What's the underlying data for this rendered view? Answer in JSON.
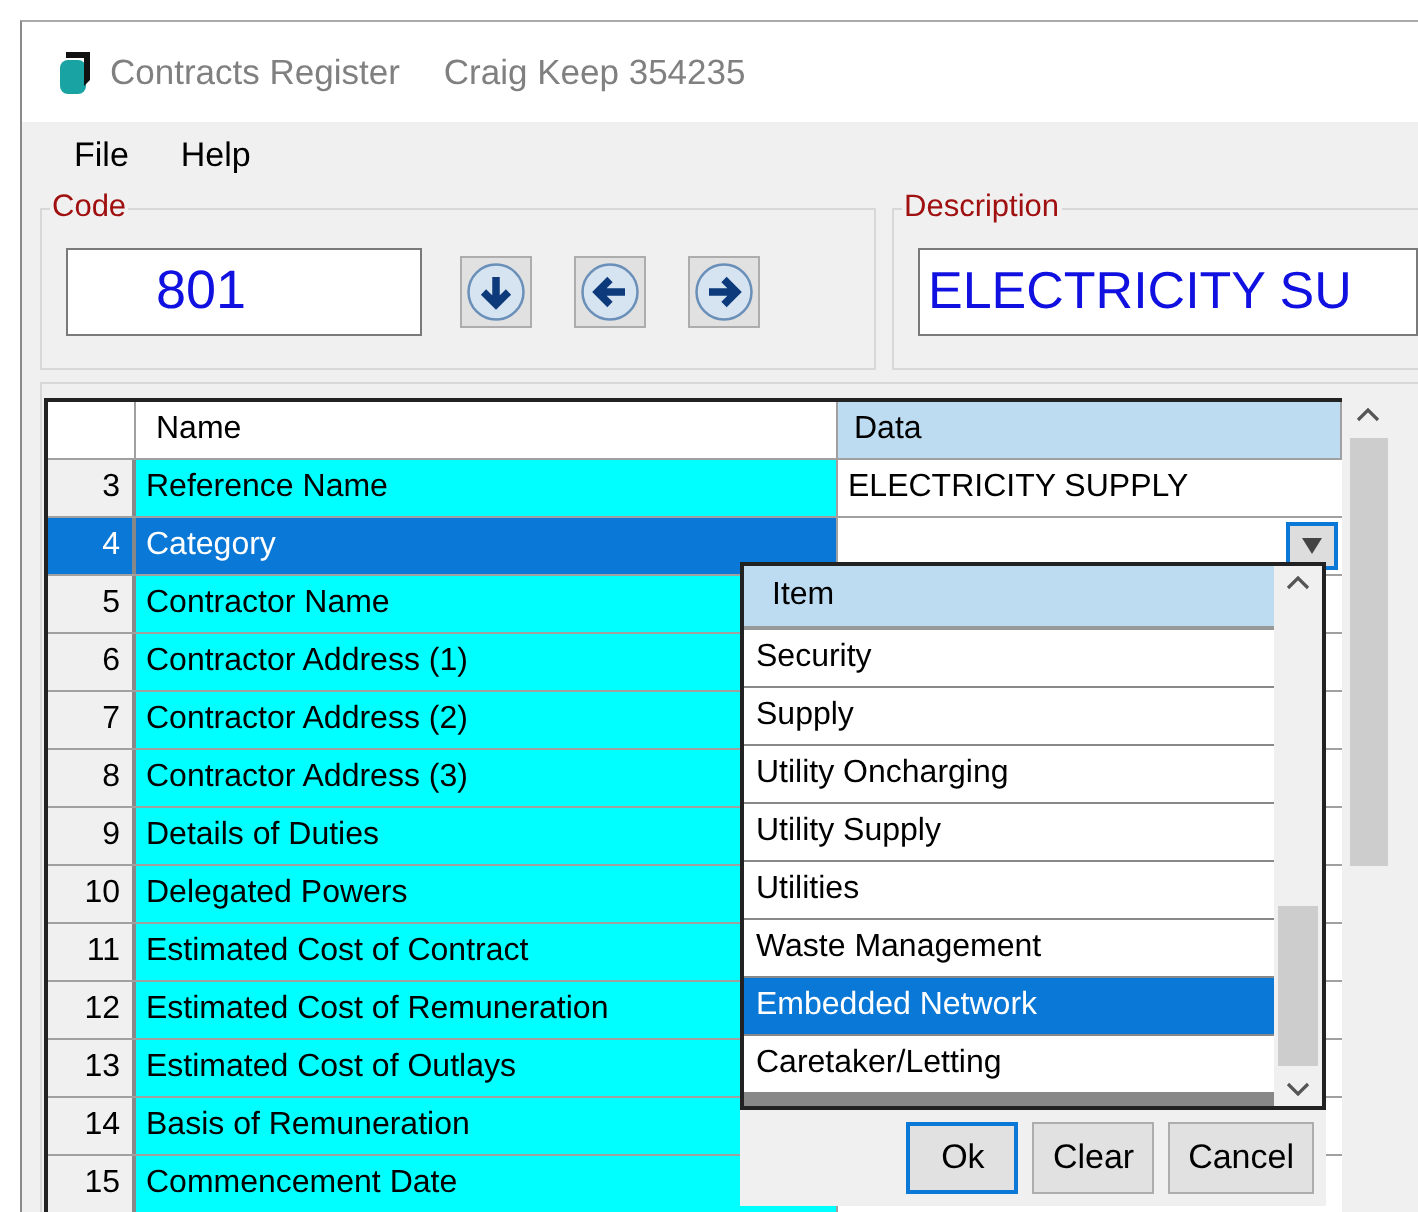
{
  "window": {
    "title": "Contracts Register",
    "user": "Craig Keep  354235"
  },
  "menu": [
    "File",
    "Help"
  ],
  "code": {
    "label": "Code",
    "value": "801"
  },
  "nav_buttons": [
    {
      "kind": "down"
    },
    {
      "kind": "left"
    },
    {
      "kind": "right"
    }
  ],
  "description": {
    "label": "Description",
    "value": "ELECTRICITY SU"
  },
  "grid": {
    "columns": [
      "Name",
      "Data"
    ],
    "rows": [
      {
        "number": "3",
        "name": "Reference Name",
        "data": "ELECTRICITY SUPPLY",
        "selected": false
      },
      {
        "number": "4",
        "name": "Category",
        "selected": true
      },
      {
        "number": "5",
        "name": "Contractor Name",
        "selected": false
      },
      {
        "number": "6",
        "name": "Contractor Address (1)",
        "selected": false
      },
      {
        "number": "7",
        "name": "Contractor Address (2)",
        "selected": false
      },
      {
        "number": "8",
        "name": "Contractor Address (3)",
        "selected": false
      },
      {
        "number": "9",
        "name": "Details of Duties",
        "selected": false
      },
      {
        "number": "10",
        "name": "Delegated Powers",
        "selected": false
      },
      {
        "number": "11",
        "name": "Estimated Cost of Contract",
        "selected": false
      },
      {
        "number": "12",
        "name": "Estimated Cost of Remuneration",
        "selected": false
      },
      {
        "number": "13",
        "name": "Estimated Cost of Outlays",
        "selected": false
      },
      {
        "number": "14",
        "name": "Basis of Remuneration",
        "selected": false
      },
      {
        "number": "15",
        "name": "Commencement Date",
        "selected": false
      }
    ]
  },
  "dropdown": {
    "column": "Item",
    "items": [
      {
        "label": "Security",
        "selected": false
      },
      {
        "label": "Supply",
        "selected": false
      },
      {
        "label": "Utility Oncharging",
        "selected": false
      },
      {
        "label": "Utility Supply",
        "selected": false
      },
      {
        "label": "Utilities",
        "selected": false
      },
      {
        "label": "Waste Management",
        "selected": false
      },
      {
        "label": "Embedded Network",
        "selected": true
      },
      {
        "label": "Caretaker/Letting",
        "selected": false
      }
    ],
    "buttons": [
      {
        "label": "Ok",
        "default": true
      },
      {
        "label": "Clear",
        "default": false
      },
      {
        "label": "Cancel",
        "default": false
      }
    ]
  }
}
